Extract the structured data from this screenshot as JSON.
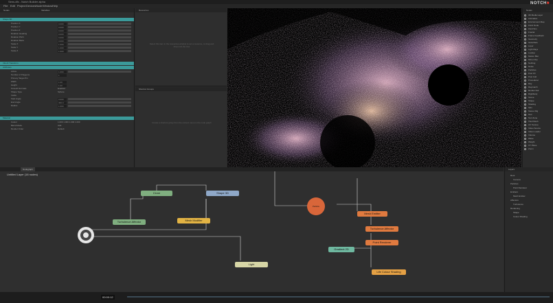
{
  "window": {
    "title": "Sens.dfx - Notch Builder alpha"
  },
  "menu": [
    "File",
    "Edit",
    "Project",
    "Devices",
    "Node",
    "Window",
    "Help"
  ],
  "properties": {
    "tab": "Nodes",
    "search_col": "Variables",
    "sections": [
      {
        "label": "Shape 3D",
        "rows": [
          {
            "label": "Position X",
            "val": "0.000"
          },
          {
            "label": "Position Y",
            "val": "0.000"
          },
          {
            "label": "Position Z",
            "val": "0.000"
          },
          {
            "label": "Rotation Heading",
            "val": "0.000"
          },
          {
            "label": "Rotation Pitch",
            "val": "0.000"
          },
          {
            "label": "Rotation Bank",
            "val": "0.000"
          },
          {
            "label": "Scale X",
            "val": "1.000"
          },
          {
            "label": "Scale Y",
            "val": "1.000"
          },
          {
            "label": "Scale Z",
            "val": "1.000"
          }
        ]
      },
      {
        "label": "Inherit Transform"
      },
      {
        "label": "Attributes",
        "rows": [
          {
            "label": "Active",
            "val": "1.000"
          },
          {
            "label": "Number of Polygons",
            "val": "1"
          },
          {
            "label": "Primary Target Pin",
            "txt": ""
          },
          {
            "label": "Width",
            "val": "1.00"
          },
          {
            "label": "Height",
            "val": "1.00"
          },
          {
            "label": "Smooth Normals",
            "txt": "Enabled"
          },
          {
            "label": "Shape Type",
            "txt": "Sphere"
          },
          {
            "label": "Inside",
            "txt": ""
          },
          {
            "label": "Start Angle",
            "val": "0.000"
          },
          {
            "label": "End Angle",
            "val": "360.0"
          },
          {
            "label": "Radius",
            "val": "1.000"
          }
        ]
      },
      {
        "label": "Material",
        "rows": [
          {
            "label": "Colour",
            "txt": "1.000 1.000 1.000 1.000"
          },
          {
            "label": "Blend Mode",
            "txt": "Add"
          },
          {
            "label": "Render Order",
            "txt": "Default"
          }
        ]
      }
    ]
  },
  "resources": {
    "title": "Resources",
    "message": "Select this item in the resources window to set a resource, or drag and drop onto the tree"
  },
  "shortcut": {
    "title": "Shortcut Groups",
    "message": "Create a shortcut group from the context menu in the node graph"
  },
  "logo": {
    "text1": "NOTCH",
    "text2": "■"
  },
  "nodelist": {
    "title": "Nodes",
    "items": [
      "3D Media Layer",
      "Animation",
      "Environment Map",
      "Flock Node",
      "Fluid Sim",
      "Fractal",
      "Frame Feedback",
      "Geometry",
      "Isosurface",
      "Layer",
      "Light Rays",
      "Lookup",
      "Motion Blur",
      "Mirror Flip",
      "Nothing",
      "Noise",
      "Particles",
      "Post FX",
      "Post Cull",
      "Procedural",
      "Ray",
      "Raymarch",
      "Render Dof",
      "Rigidbody",
      "Scene",
      "Shape",
      "Shading",
      "Skin",
      "Stereo Rig",
      "Text",
      "Text Zone",
      "Tiled Mesh",
      "UV Texture",
      "Video Source",
      "Video Loader",
      "Volume",
      "Wave",
      "Weight",
      "XY Plane",
      "Zoom"
    ]
  },
  "graph": {
    "tab": "Nodegraph",
    "layer": "Untitled Layer (16 nodes)",
    "nodes": [
      {
        "id": "clone",
        "label": "Clone",
        "color": "#7fae7f"
      },
      {
        "id": "shape3d",
        "label": "Shape 3D",
        "color": "#8fa8c8"
      },
      {
        "id": "turbulence",
        "label": "Turbulence Affector",
        "color": "#7fae7f"
      },
      {
        "id": "mesh",
        "label": "Mesh Modifier",
        "color": "#e2b344"
      },
      {
        "id": "particle",
        "label": "Particle",
        "color": "#d8663a"
      },
      {
        "id": "mesh_emitter",
        "label": "Mesh Emitter",
        "color": "#e07a3f"
      },
      {
        "id": "turbulence2",
        "label": "Turbulence Affector",
        "color": "#e07a3f"
      },
      {
        "id": "point_renderer",
        "label": "Point Renderer",
        "color": "#e07a3f"
      },
      {
        "id": "gradient",
        "label": "Gradient 2D",
        "color": "#6fb8a0"
      },
      {
        "id": "light",
        "label": "Light",
        "color": "#d7d6a6"
      },
      {
        "id": "lcs",
        "label": "Life Colour Shading",
        "color": "#e4a044"
      }
    ]
  },
  "tree": {
    "title": "Layers",
    "items": [
      "Root",
      "Camera",
      "Particles",
      "Point Renderer",
      "Emitters",
      "Mesh Emitter",
      "Affectors",
      "Turbulence",
      "Rendering",
      "Shape",
      "Colour Shading"
    ]
  },
  "timeline": {
    "time": "00:00:12"
  }
}
